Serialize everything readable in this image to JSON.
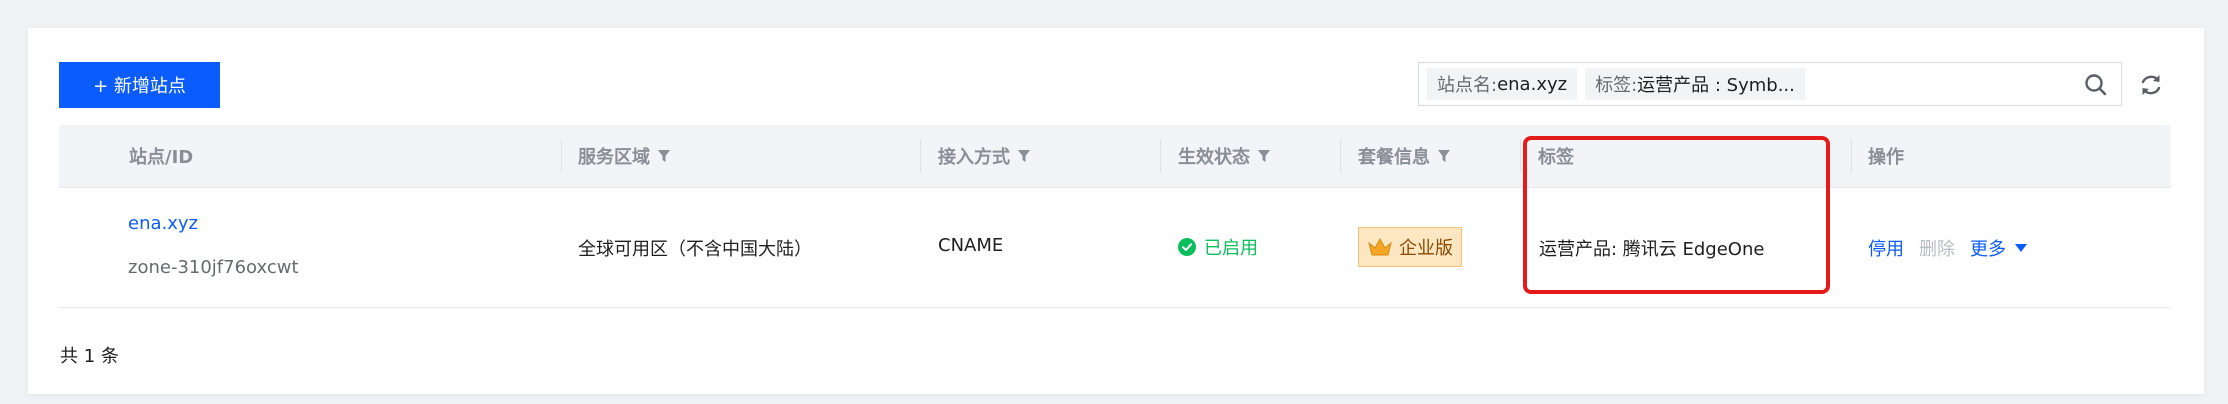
{
  "toolbar": {
    "add_site_label": "+ 新增站点",
    "filters": [
      {
        "key": "站点名:",
        "value": "ena.xyz"
      },
      {
        "key": "标签:",
        "value": "运营产品 : Symb..."
      }
    ]
  },
  "table": {
    "columns": [
      {
        "label": "站点/ID",
        "filterable": false
      },
      {
        "label": "服务区域",
        "filterable": true
      },
      {
        "label": "接入方式",
        "filterable": true
      },
      {
        "label": "生效状态",
        "filterable": true
      },
      {
        "label": "套餐信息",
        "filterable": true
      },
      {
        "label": "标签",
        "filterable": false
      },
      {
        "label": "操作",
        "filterable": false
      }
    ],
    "rows": [
      {
        "site_name": "ena.xyz",
        "zone_id": "zone-310jf76oxcwt",
        "service_area": "全球可用区（不含中国大陆）",
        "access_mode": "CNAME",
        "status": "已启用",
        "plan": "企业版",
        "tags": "运营产品: 腾讯云 EdgeOne",
        "actions": {
          "disable": "停用",
          "delete": "删除",
          "more": "更多"
        }
      }
    ]
  },
  "footer": {
    "total_label": "共 1 条"
  },
  "colors": {
    "primary": "#0a5cff",
    "success": "#0abf5b",
    "highlight": "#e31b1b",
    "plan_badge_bg": "#fde7c2"
  }
}
